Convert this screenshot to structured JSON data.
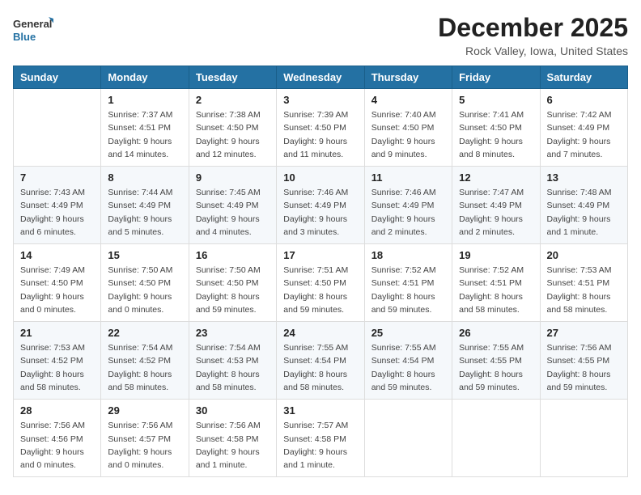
{
  "logo": {
    "text_general": "General",
    "text_blue": "Blue"
  },
  "title": "December 2025",
  "location": "Rock Valley, Iowa, United States",
  "days_of_week": [
    "Sunday",
    "Monday",
    "Tuesday",
    "Wednesday",
    "Thursday",
    "Friday",
    "Saturday"
  ],
  "weeks": [
    [
      {
        "day": "",
        "info": ""
      },
      {
        "day": "1",
        "info": "Sunrise: 7:37 AM\nSunset: 4:51 PM\nDaylight: 9 hours\nand 14 minutes."
      },
      {
        "day": "2",
        "info": "Sunrise: 7:38 AM\nSunset: 4:50 PM\nDaylight: 9 hours\nand 12 minutes."
      },
      {
        "day": "3",
        "info": "Sunrise: 7:39 AM\nSunset: 4:50 PM\nDaylight: 9 hours\nand 11 minutes."
      },
      {
        "day": "4",
        "info": "Sunrise: 7:40 AM\nSunset: 4:50 PM\nDaylight: 9 hours\nand 9 minutes."
      },
      {
        "day": "5",
        "info": "Sunrise: 7:41 AM\nSunset: 4:50 PM\nDaylight: 9 hours\nand 8 minutes."
      },
      {
        "day": "6",
        "info": "Sunrise: 7:42 AM\nSunset: 4:49 PM\nDaylight: 9 hours\nand 7 minutes."
      }
    ],
    [
      {
        "day": "7",
        "info": "Sunrise: 7:43 AM\nSunset: 4:49 PM\nDaylight: 9 hours\nand 6 minutes."
      },
      {
        "day": "8",
        "info": "Sunrise: 7:44 AM\nSunset: 4:49 PM\nDaylight: 9 hours\nand 5 minutes."
      },
      {
        "day": "9",
        "info": "Sunrise: 7:45 AM\nSunset: 4:49 PM\nDaylight: 9 hours\nand 4 minutes."
      },
      {
        "day": "10",
        "info": "Sunrise: 7:46 AM\nSunset: 4:49 PM\nDaylight: 9 hours\nand 3 minutes."
      },
      {
        "day": "11",
        "info": "Sunrise: 7:46 AM\nSunset: 4:49 PM\nDaylight: 9 hours\nand 2 minutes."
      },
      {
        "day": "12",
        "info": "Sunrise: 7:47 AM\nSunset: 4:49 PM\nDaylight: 9 hours\nand 2 minutes."
      },
      {
        "day": "13",
        "info": "Sunrise: 7:48 AM\nSunset: 4:49 PM\nDaylight: 9 hours\nand 1 minute."
      }
    ],
    [
      {
        "day": "14",
        "info": "Sunrise: 7:49 AM\nSunset: 4:50 PM\nDaylight: 9 hours\nand 0 minutes."
      },
      {
        "day": "15",
        "info": "Sunrise: 7:50 AM\nSunset: 4:50 PM\nDaylight: 9 hours\nand 0 minutes."
      },
      {
        "day": "16",
        "info": "Sunrise: 7:50 AM\nSunset: 4:50 PM\nDaylight: 8 hours\nand 59 minutes."
      },
      {
        "day": "17",
        "info": "Sunrise: 7:51 AM\nSunset: 4:50 PM\nDaylight: 8 hours\nand 59 minutes."
      },
      {
        "day": "18",
        "info": "Sunrise: 7:52 AM\nSunset: 4:51 PM\nDaylight: 8 hours\nand 59 minutes."
      },
      {
        "day": "19",
        "info": "Sunrise: 7:52 AM\nSunset: 4:51 PM\nDaylight: 8 hours\nand 58 minutes."
      },
      {
        "day": "20",
        "info": "Sunrise: 7:53 AM\nSunset: 4:51 PM\nDaylight: 8 hours\nand 58 minutes."
      }
    ],
    [
      {
        "day": "21",
        "info": "Sunrise: 7:53 AM\nSunset: 4:52 PM\nDaylight: 8 hours\nand 58 minutes."
      },
      {
        "day": "22",
        "info": "Sunrise: 7:54 AM\nSunset: 4:52 PM\nDaylight: 8 hours\nand 58 minutes."
      },
      {
        "day": "23",
        "info": "Sunrise: 7:54 AM\nSunset: 4:53 PM\nDaylight: 8 hours\nand 58 minutes."
      },
      {
        "day": "24",
        "info": "Sunrise: 7:55 AM\nSunset: 4:54 PM\nDaylight: 8 hours\nand 58 minutes."
      },
      {
        "day": "25",
        "info": "Sunrise: 7:55 AM\nSunset: 4:54 PM\nDaylight: 8 hours\nand 59 minutes."
      },
      {
        "day": "26",
        "info": "Sunrise: 7:55 AM\nSunset: 4:55 PM\nDaylight: 8 hours\nand 59 minutes."
      },
      {
        "day": "27",
        "info": "Sunrise: 7:56 AM\nSunset: 4:55 PM\nDaylight: 8 hours\nand 59 minutes."
      }
    ],
    [
      {
        "day": "28",
        "info": "Sunrise: 7:56 AM\nSunset: 4:56 PM\nDaylight: 9 hours\nand 0 minutes."
      },
      {
        "day": "29",
        "info": "Sunrise: 7:56 AM\nSunset: 4:57 PM\nDaylight: 9 hours\nand 0 minutes."
      },
      {
        "day": "30",
        "info": "Sunrise: 7:56 AM\nSunset: 4:58 PM\nDaylight: 9 hours\nand 1 minute."
      },
      {
        "day": "31",
        "info": "Sunrise: 7:57 AM\nSunset: 4:58 PM\nDaylight: 9 hours\nand 1 minute."
      },
      {
        "day": "",
        "info": ""
      },
      {
        "day": "",
        "info": ""
      },
      {
        "day": "",
        "info": ""
      }
    ]
  ]
}
